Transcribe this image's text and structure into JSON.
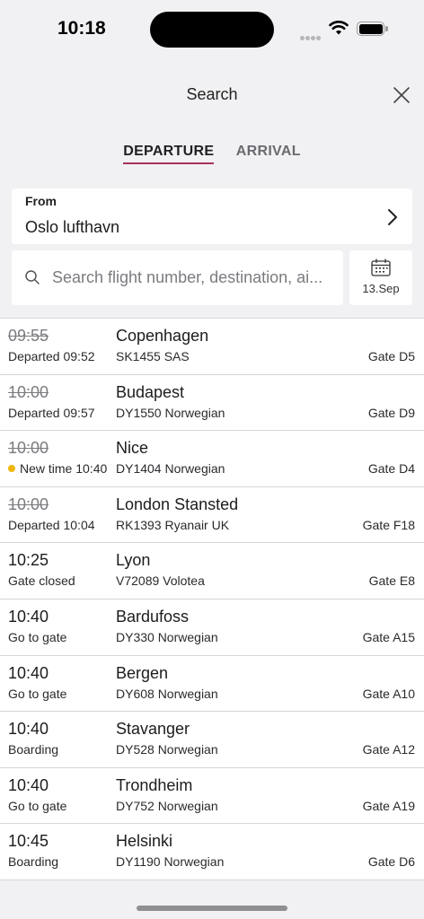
{
  "status_bar": {
    "time": "10:18"
  },
  "header": {
    "title": "Search"
  },
  "tabs": [
    {
      "label": "DEPARTURE",
      "active": true
    },
    {
      "label": "ARRIVAL",
      "active": false
    }
  ],
  "from": {
    "label": "From",
    "value": "Oslo lufthavn"
  },
  "search": {
    "placeholder": "Search flight number, destination, ai..."
  },
  "date": {
    "label": "13.Sep"
  },
  "colors": {
    "accent": "#a8325a",
    "status_dot": "#f1b60b"
  },
  "flights": [
    {
      "time": "09:55",
      "struck": true,
      "status": "Departed 09:52",
      "dot": false,
      "destination": "Copenhagen",
      "flight": "SK1455 SAS",
      "gate": "Gate D5"
    },
    {
      "time": "10:00",
      "struck": true,
      "status": "Departed 09:57",
      "dot": false,
      "destination": "Budapest",
      "flight": "DY1550 Norwegian",
      "gate": "Gate D9"
    },
    {
      "time": "10:00",
      "struck": true,
      "status": "New time 10:40",
      "dot": true,
      "destination": "Nice",
      "flight": "DY1404 Norwegian",
      "gate": "Gate D4"
    },
    {
      "time": "10:00",
      "struck": true,
      "status": "Departed 10:04",
      "dot": false,
      "destination": "London Stansted",
      "flight": "RK1393 Ryanair UK",
      "gate": "Gate F18"
    },
    {
      "time": "10:25",
      "struck": false,
      "status": "Gate closed",
      "dot": false,
      "destination": "Lyon",
      "flight": "V72089 Volotea",
      "gate": "Gate E8"
    },
    {
      "time": "10:40",
      "struck": false,
      "status": "Go to gate",
      "dot": false,
      "destination": "Bardufoss",
      "flight": "DY330 Norwegian",
      "gate": "Gate A15"
    },
    {
      "time": "10:40",
      "struck": false,
      "status": "Go to gate",
      "dot": false,
      "destination": "Bergen",
      "flight": "DY608 Norwegian",
      "gate": "Gate A10"
    },
    {
      "time": "10:40",
      "struck": false,
      "status": "Boarding",
      "dot": false,
      "destination": "Stavanger",
      "flight": "DY528 Norwegian",
      "gate": "Gate A12"
    },
    {
      "time": "10:40",
      "struck": false,
      "status": "Go to gate",
      "dot": false,
      "destination": "Trondheim",
      "flight": "DY752 Norwegian",
      "gate": "Gate A19"
    },
    {
      "time": "10:45",
      "struck": false,
      "status": "Boarding",
      "dot": false,
      "destination": "Helsinki",
      "flight": "DY1190 Norwegian",
      "gate": "Gate D6"
    }
  ]
}
